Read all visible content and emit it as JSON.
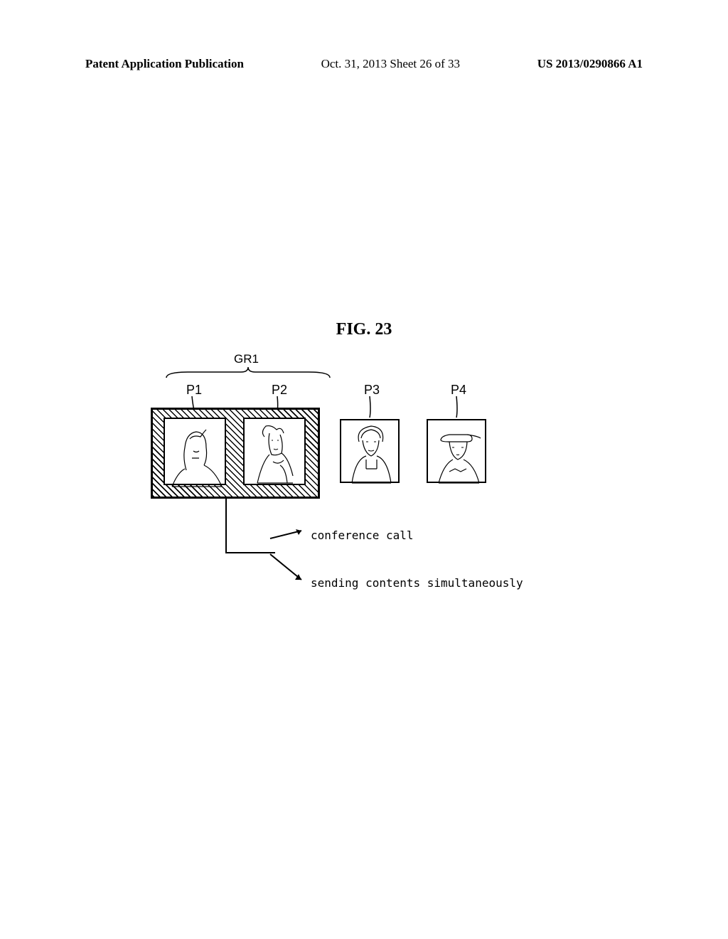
{
  "header": {
    "left": "Patent Application Publication",
    "center": "Oct. 31, 2013  Sheet 26 of 33",
    "right": "US 2013/0290866 A1"
  },
  "figure_title": "FIG. 23",
  "labels": {
    "gr1": "GR1",
    "p1": "P1",
    "p2": "P2",
    "p3": "P3",
    "p4": "P4"
  },
  "actions": {
    "conference": "conference call",
    "sending": "sending contents simultaneously"
  }
}
